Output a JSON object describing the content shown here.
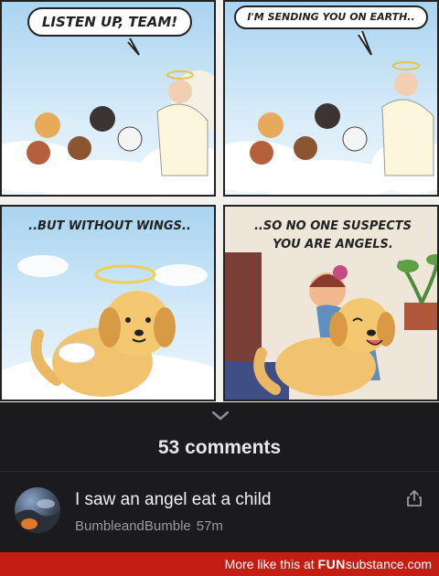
{
  "comic": {
    "panel1": {
      "bubble": "LISTEN UP, TEAM!"
    },
    "panel2": {
      "bubble": "I'M SENDING YOU ON EARTH.."
    },
    "panel3": {
      "caption": "..BUT WITHOUT WINGS.."
    },
    "panel4": {
      "caption_line1": "..SO NO ONE SUSPECTS",
      "caption_line2": "YOU ARE ANGELS."
    }
  },
  "comments": {
    "count_label": "53 comments",
    "items": [
      {
        "text": "I saw an angel eat a child",
        "author": "BumbleandBumble",
        "age": "57m"
      }
    ]
  },
  "icons": {
    "expand": "chevron-down-icon",
    "share": "share-icon"
  },
  "banner": {
    "prefix": "More like this at ",
    "brand_a": "FUN",
    "brand_b": "substance",
    "brand_c": ".com"
  },
  "colors": {
    "banner": "#c41e14",
    "background": "#1b1b1d"
  }
}
